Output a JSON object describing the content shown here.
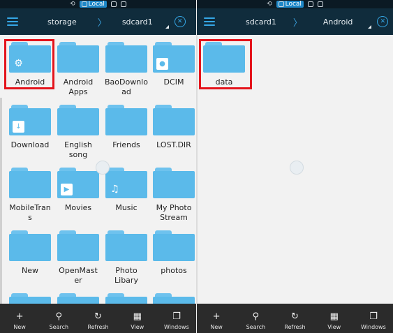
{
  "left": {
    "status": {
      "local_label": "Local"
    },
    "path": {
      "crumbs": [
        "storage",
        "sdcard1"
      ],
      "separator": "〉"
    },
    "folders": [
      {
        "label": "Android",
        "overlay": "⚙"
      },
      {
        "label": "Android Apps",
        "overlay": ""
      },
      {
        "label": "BaoDownload",
        "overlay": ""
      },
      {
        "label": "DCIM",
        "overlay": "📷"
      },
      {
        "label": "Download",
        "overlay": "↓"
      },
      {
        "label": "English song",
        "overlay": ""
      },
      {
        "label": "Friends",
        "overlay": ""
      },
      {
        "label": "LOST.DIR",
        "overlay": ""
      },
      {
        "label": "MobileTrans",
        "overlay": ""
      },
      {
        "label": "Movies",
        "overlay": "▶"
      },
      {
        "label": "Music",
        "overlay": "♫"
      },
      {
        "label": "My Photo Stream",
        "overlay": ""
      },
      {
        "label": "New",
        "overlay": ""
      },
      {
        "label": "OpenMaster",
        "overlay": ""
      },
      {
        "label": "Photo Libary",
        "overlay": ""
      },
      {
        "label": "photos",
        "overlay": ""
      }
    ]
  },
  "right": {
    "status": {
      "local_label": "Local"
    },
    "path": {
      "crumbs": [
        "sdcard1",
        "Android"
      ],
      "separator": "〉"
    },
    "folders": [
      {
        "label": "data",
        "overlay": ""
      }
    ]
  },
  "toolbar": {
    "items": [
      {
        "label": "New",
        "glyph": "+"
      },
      {
        "label": "Search",
        "glyph": "⚲"
      },
      {
        "label": "Refresh",
        "glyph": "↻"
      },
      {
        "label": "View",
        "glyph": "▦"
      },
      {
        "label": "Windows",
        "glyph": "❐"
      }
    ]
  },
  "colors": {
    "highlight": "#e4141c",
    "folder": "#5bbaea",
    "pathbar": "#102c3c",
    "accent": "#35a7e6"
  }
}
